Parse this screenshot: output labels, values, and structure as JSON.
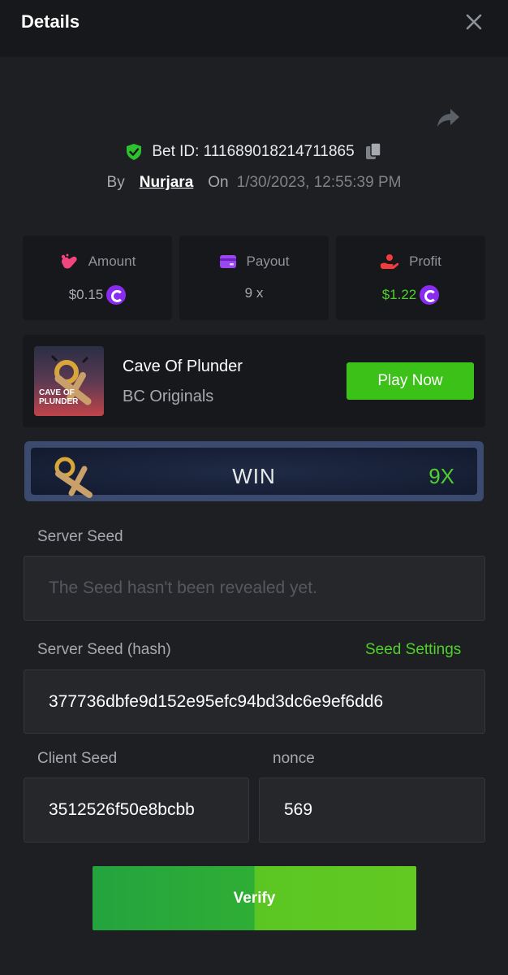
{
  "header": {
    "title": "Details"
  },
  "bet": {
    "id_text": "Bet ID: 111689018214711865",
    "by_label": "By",
    "username": "Nurjara",
    "on_label": "On",
    "datetime": "1/30/2023, 12:55:39 PM"
  },
  "stats": {
    "amount": {
      "label": "Amount",
      "value": "$0.15"
    },
    "payout": {
      "label": "Payout",
      "value": "9 x"
    },
    "profit": {
      "label": "Profit",
      "value": "$1.22"
    }
  },
  "game": {
    "name": "Cave Of Plunder",
    "provider": "BC Originals",
    "thumb_text_1": "CAVE OF",
    "thumb_text_2": "PLUNDER",
    "play_label": "Play Now"
  },
  "result": {
    "label": "WIN",
    "multiplier": "9X"
  },
  "server_seed": {
    "label": "Server Seed",
    "placeholder": "The Seed hasn't been revealed yet."
  },
  "server_seed_hash": {
    "label": "Server Seed (hash)",
    "settings_link": "Seed Settings",
    "value": "377736dbfe9d152e95efc94bd3dc6e9ef6dd6"
  },
  "client_seed": {
    "label": "Client Seed",
    "value": "3512526f50e8bcbb"
  },
  "nonce": {
    "label": "nonce",
    "value": "569"
  },
  "verify_label": "Verify",
  "colors": {
    "accent_green": "#3bc117",
    "text_green": "#4fd02b",
    "coin_purple": "#8a2cf0",
    "background": "#1e1f22",
    "panel": "#17181b"
  },
  "icons": [
    "close-icon",
    "share-icon",
    "shield-check-icon",
    "copy-icon",
    "amount-icon",
    "payout-card-icon",
    "profit-hand-icon",
    "coin-icon"
  ]
}
